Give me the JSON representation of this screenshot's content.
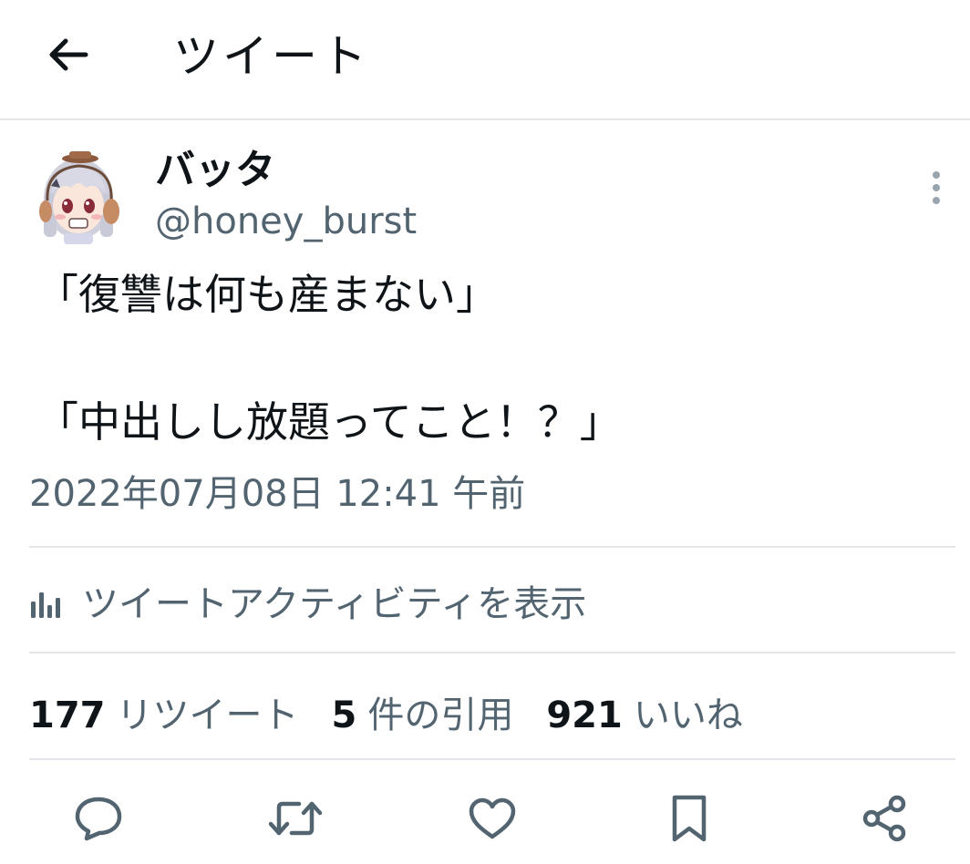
{
  "header": {
    "back_icon": "arrow-left-icon",
    "title": "ツイート"
  },
  "tweet": {
    "display_name": "バッタ",
    "handle": "@honey_burst",
    "text": "「復讐は何も産まない」\n\n「中出しし放題ってこと！？」",
    "timestamp": "2022年07月08日 12:41 午前",
    "more_icon": "more-vertical-icon"
  },
  "activity": {
    "icon": "bar-chart-icon",
    "label": "ツイートアクティビティを表示"
  },
  "stats": [
    {
      "number": "177",
      "label": "リツイート"
    },
    {
      "number": "5",
      "label": "件の引用"
    },
    {
      "number": "921",
      "label": "いいね"
    }
  ],
  "actions": [
    {
      "icon": "reply-icon"
    },
    {
      "icon": "retweet-icon"
    },
    {
      "icon": "like-icon"
    },
    {
      "icon": "bookmark-icon"
    },
    {
      "icon": "share-icon"
    }
  ],
  "colors": {
    "text_primary": "#0f1419",
    "text_secondary": "#536471",
    "divider": "#e3e5e8"
  }
}
